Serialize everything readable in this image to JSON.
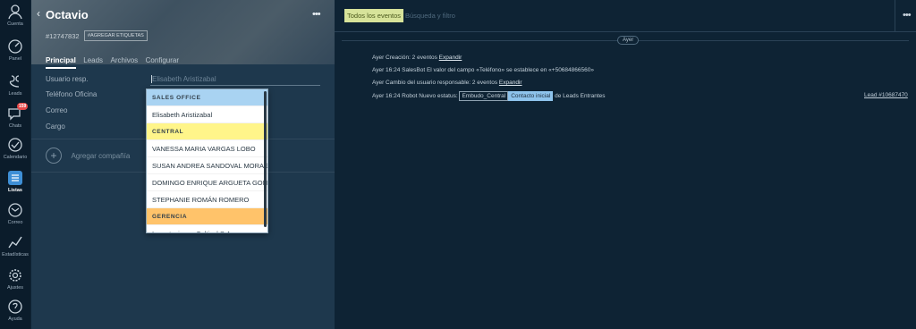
{
  "nav": {
    "items": [
      {
        "label": "Cuenta",
        "icon": "user-icon"
      },
      {
        "label": "Panel",
        "icon": "dashboard-icon"
      },
      {
        "label": "Leads",
        "icon": "leads-icon"
      },
      {
        "label": "Chats",
        "icon": "chat-icon",
        "badge": "159"
      },
      {
        "label": "Calendario",
        "icon": "calendar-check-icon"
      },
      {
        "label": "Listas",
        "icon": "lists-icon"
      },
      {
        "label": "Correo",
        "icon": "mail-icon"
      },
      {
        "label": "Estadísticas",
        "icon": "stats-icon"
      },
      {
        "label": "Ajustes",
        "icon": "gear-icon"
      },
      {
        "label": "Ayuda",
        "icon": "help-icon"
      }
    ]
  },
  "card": {
    "name": "Octavio",
    "id": "#12747832",
    "tag_button": "#AGREGAR ETIQUETAS",
    "tabs": [
      "Principal",
      "Leads",
      "Archivos",
      "Configurar"
    ],
    "fields": {
      "resp_label": "Usuario resp.",
      "resp_value": "Elisabeth Aristizabal",
      "phone_label": "Teléfono Oficina",
      "email_label": "Correo",
      "position_label": "Cargo"
    },
    "add_company": "Agregar compañía",
    "dropdown": [
      {
        "text": "SALES OFFICE",
        "group": "blue"
      },
      {
        "text": "Elisabeth Aristizabal"
      },
      {
        "text": "CENTRAL",
        "group": "yellow"
      },
      {
        "text": "VANESSA MARIA VARGAS LOBO"
      },
      {
        "text": "SUSAN ANDREA SANDOVAL MORAGA"
      },
      {
        "text": "DOMINGO ENRIQUE ARGUETA GONZALEZ"
      },
      {
        "text": "STEPHANIE ROMÁN ROMERO"
      },
      {
        "text": "GERENCIA",
        "group": "orange"
      },
      {
        "text": "Importaciones Colticel S.A."
      }
    ]
  },
  "feed": {
    "filter": "Todos los eventos",
    "search_placeholder": "Búsqueda y filtro",
    "day": "Ayer",
    "events": [
      {
        "text": "Ayer Creación: 2 eventos ",
        "link": "Expandir"
      },
      {
        "text": "Ayer 16:24 SalesBot El valor del campo «Teléfono» se establece en «+50684866560»"
      },
      {
        "text": "Ayer Cambio del usuario responsable: 2 eventos ",
        "link": "Expandir"
      }
    ],
    "status_event": {
      "prefix": "Ayer 16:24 Robot Nuevo estatus:",
      "pipeline": "Embudo_Central",
      "status": "Contacto inicial",
      "suffix": "de Leads Entrantes",
      "lead_link": "Lead #10687470"
    }
  }
}
